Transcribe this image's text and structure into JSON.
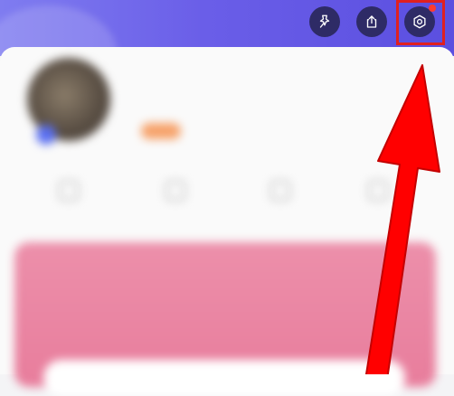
{
  "header": {
    "buttons": [
      {
        "name": "pin-icon"
      },
      {
        "name": "share-icon"
      },
      {
        "name": "settings-icon",
        "has_notification": true
      }
    ]
  },
  "profile": {
    "name": "",
    "name_extra": "",
    "subtitle": "",
    "tag": ""
  },
  "stats": [
    {
      "icon": "stat-icon",
      "label": ""
    },
    {
      "icon": "stat-icon",
      "label": ""
    },
    {
      "icon": "stat-icon",
      "label": ""
    },
    {
      "icon": "stat-icon",
      "label": ""
    }
  ],
  "promo": {
    "title": "",
    "subtitle": ""
  },
  "annotation": {
    "highlight_color": "#e02020",
    "arrow_color": "#ff0000",
    "target": "settings-button"
  },
  "colors": {
    "header_start": "#7f7cf0",
    "header_end": "#5b4fe0",
    "button_bg": "#2e2b66",
    "promo_bg": "#ec8faa"
  }
}
